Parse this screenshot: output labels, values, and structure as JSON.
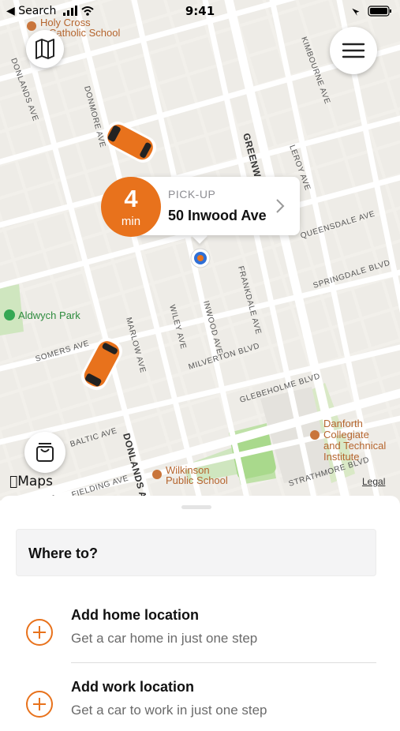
{
  "status_bar": {
    "back_label": "◀ Search",
    "time": "9:41"
  },
  "map": {
    "streets": [
      "DONLANDS AVE",
      "KIMBOURNE AVE",
      "DONMORE AVE",
      "GREENWOOD",
      "LEROY AVE",
      "QUEENSDALE AVE",
      "FRANKDALE AVE",
      "SPRINGDALE BLVD",
      "INWOOD AVE",
      "WILEY AVE",
      "MARLOW AVE",
      "SOMERS AVE",
      "MILVERTON BLVD",
      "GLEBEHOLME BLVD",
      "BALTIC AVE",
      "DONLANDS AVE",
      "STRATHMORE BLVD",
      "FIELDING AVE",
      "SPR"
    ],
    "places": {
      "school_top": [
        "Holy Cross",
        "Catholic School"
      ],
      "park": "Aldwych Park",
      "wilkinson": [
        "Wilkinson",
        "Public School"
      ],
      "danforth": [
        "Danforth",
        "Collegiate",
        "and Technical",
        "Institute"
      ]
    },
    "brand": "Maps",
    "legal": "Legal",
    "accent_color": "#E8721C"
  },
  "pickup": {
    "eta_value": "4",
    "eta_unit": "min",
    "label": "PICK-UP",
    "address": "50 Inwood Ave"
  },
  "sheet": {
    "search_placeholder": "Where to?",
    "shortcuts": [
      {
        "title": "Add home location",
        "subtitle": "Get a car home in just one step"
      },
      {
        "title": "Add work location",
        "subtitle": "Get a car to work in just one step"
      }
    ]
  }
}
